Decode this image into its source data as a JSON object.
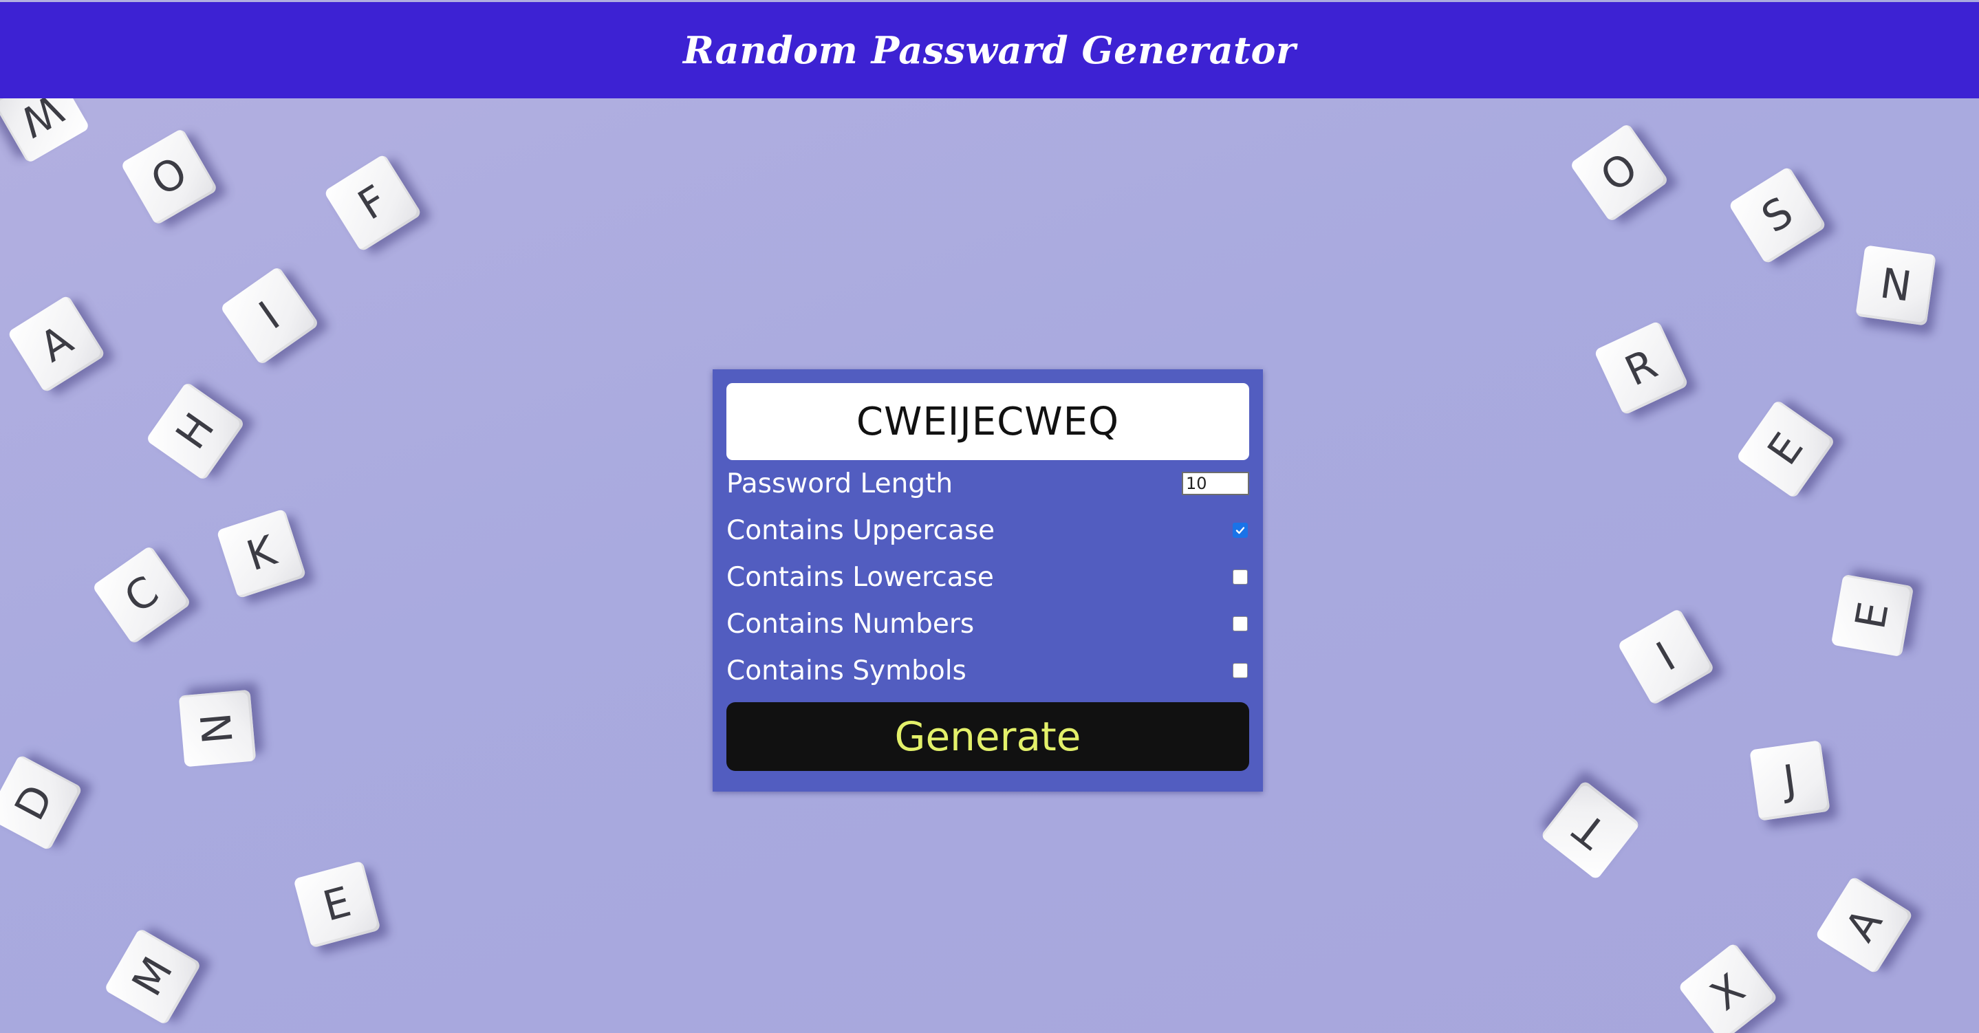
{
  "header": {
    "title": "Random Passward Generator",
    "background": "#3d22d3"
  },
  "generator": {
    "password": "CWEIJECWEQ",
    "length_label": "Password Length",
    "length_value": "10",
    "options": [
      {
        "label": "Contains Uppercase",
        "checked": true
      },
      {
        "label": "Contains Lowercase",
        "checked": false
      },
      {
        "label": "Contains Numbers",
        "checked": false
      },
      {
        "label": "Contains Symbols",
        "checked": false
      }
    ],
    "generate_label": "Generate",
    "card_color": "#525dc0",
    "button_text_color": "#e3f06a"
  },
  "background_tiles": {
    "left": [
      "W",
      "O",
      "F",
      "A",
      "I",
      "H",
      "K",
      "C",
      "N",
      "D",
      "E",
      "M"
    ],
    "right": [
      "O",
      "S",
      "N",
      "R",
      "E",
      "E",
      "I",
      "J",
      "T",
      "A",
      "X"
    ]
  }
}
